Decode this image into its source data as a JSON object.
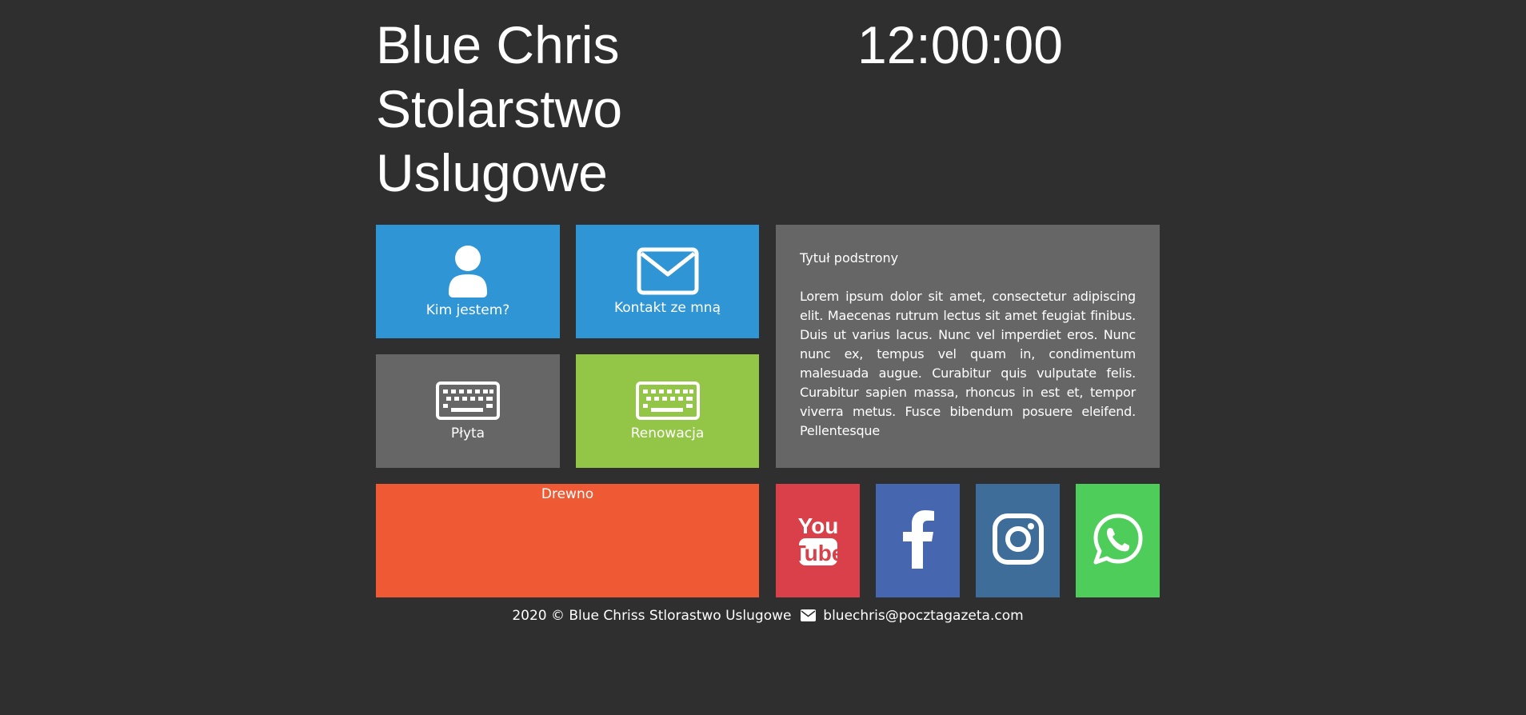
{
  "header": {
    "site_title": "Blue Chris\nStolarstwo\nUslugowe",
    "clock": "12:00:00"
  },
  "tiles": [
    {
      "label": "Kim jestem?",
      "icon": "user-icon",
      "color": "#2f95d4"
    },
    {
      "label": "Kontakt ze mną",
      "icon": "envelope-icon",
      "color": "#2f95d4"
    },
    {
      "label": "Płyta",
      "icon": "keyboard-icon",
      "color": "#666666"
    },
    {
      "label": "Renowacja",
      "icon": "keyboard-icon",
      "color": "#93c647"
    },
    {
      "label": "Drewno",
      "icon": "",
      "color": "#ef5a34"
    }
  ],
  "content": {
    "subtitle": "Tytuł podstrony",
    "body": "Lorem ipsum dolor sit amet, consectetur adipiscing elit. Maecenas rutrum lectus sit amet feugiat finibus. Duis ut varius lacus. Nunc vel imperdiet eros. Nunc nunc ex, tempus vel quam in, condimentum malesuada augue. Curabitur quis vulputate felis. Curabitur sapien massa, rhoncus in est et, tempor viverra metus. Fusce bibendum posuere eleifend. Pellentesque",
    "color": "#666666"
  },
  "social": [
    {
      "name": "youtube-icon",
      "color": "#d9404a"
    },
    {
      "name": "facebook-icon",
      "color": "#4666b0"
    },
    {
      "name": "instagram-icon",
      "color": "#3d6d98"
    },
    {
      "name": "whatsapp-icon",
      "color": "#4fcd5b"
    }
  ],
  "footer": {
    "copyright": "2020 © Blue Chriss Stlorastwo Uslugowe",
    "email": "bluechris@pocztagazeta.com"
  },
  "colors": {
    "background": "#2f2f2f"
  }
}
